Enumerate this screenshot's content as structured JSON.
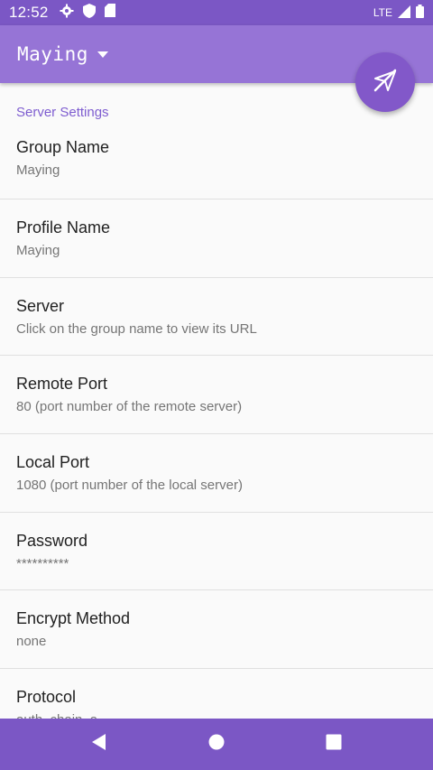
{
  "status_bar": {
    "time": "12:52",
    "network": "LTE",
    "icons": [
      "settings-icon",
      "shield-icon",
      "sd-card-icon",
      "signal-icon",
      "battery-icon"
    ]
  },
  "app_bar": {
    "title": "Maying",
    "dropdown_icon": "dropdown-arrow-icon"
  },
  "fab": {
    "icon": "disconnected-plane-icon"
  },
  "settings": {
    "section_header": "Server Settings",
    "items": [
      {
        "title": "Group Name",
        "summary": "Maying"
      },
      {
        "title": "Profile Name",
        "summary": "Maying"
      },
      {
        "title": "Server",
        "summary": "Click on the group name to view its URL"
      },
      {
        "title": "Remote Port",
        "summary": "80 (port number of the remote server)"
      },
      {
        "title": "Local Port",
        "summary": "1080 (port number of the local server)"
      },
      {
        "title": "Password",
        "summary": "**********"
      },
      {
        "title": "Encrypt Method",
        "summary": "none"
      },
      {
        "title": "Protocol",
        "summary": "auth_chain_a"
      }
    ]
  },
  "nav_bar": {
    "icons": [
      "back-icon",
      "home-icon",
      "recents-icon"
    ]
  },
  "colors": {
    "status_bar": "#7b57c5",
    "app_bar": "#9674d6",
    "accent": "#7e5dd0",
    "fab": "#8258c9",
    "nav_bar": "#7b57c5"
  }
}
